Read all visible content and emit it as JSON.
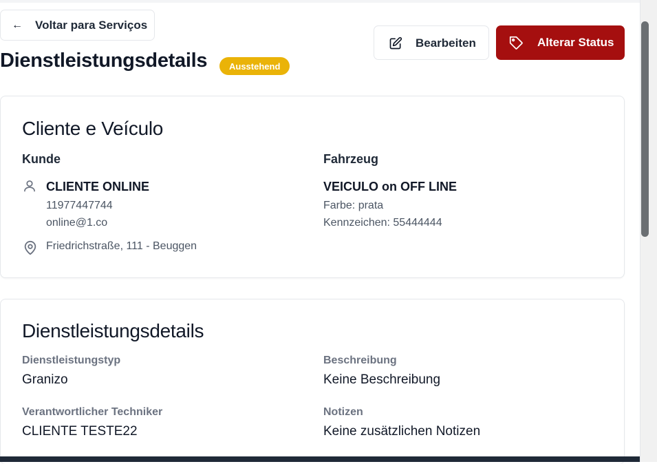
{
  "back_button": {
    "arrow": "←",
    "label": "Voltar para Serviços"
  },
  "header": {
    "title": "Dienstleistungsdetails",
    "status_badge": "Ausstehend",
    "edit_label": "Bearbeiten",
    "change_status_label": "Alterar Status"
  },
  "client_vehicle": {
    "title": "Cliente e Veículo",
    "customer_heading": "Kunde",
    "customer_name": "CLIENTE ONLINE",
    "customer_phone": "11977447744",
    "customer_email": "online@1.co",
    "customer_address": "Friedrichstraße, 111 - Beuggen",
    "vehicle_heading": "Fahrzeug",
    "vehicle_name": "VEICULO on OFF LINE",
    "vehicle_color": "Farbe: prata",
    "vehicle_plate": "Kennzeichen: 55444444"
  },
  "service_details": {
    "title": "Dienstleistungsdetails",
    "type_label": "Dienstleistungstyp",
    "type_value": "Granizo",
    "description_label": "Beschreibung",
    "description_value": "Keine Beschreibung",
    "technician_label": "Verantwortlicher Techniker",
    "technician_value": "CLIENTE TESTE22",
    "notes_label": "Notizen",
    "notes_value": "Keine zusätzlichen Notizen"
  },
  "colors": {
    "accent_red": "#a50f0f",
    "badge_yellow": "#eab308"
  },
  "icons": [
    "arrow-left-icon",
    "edit-icon",
    "tag-icon",
    "user-icon",
    "map-pin-icon"
  ]
}
